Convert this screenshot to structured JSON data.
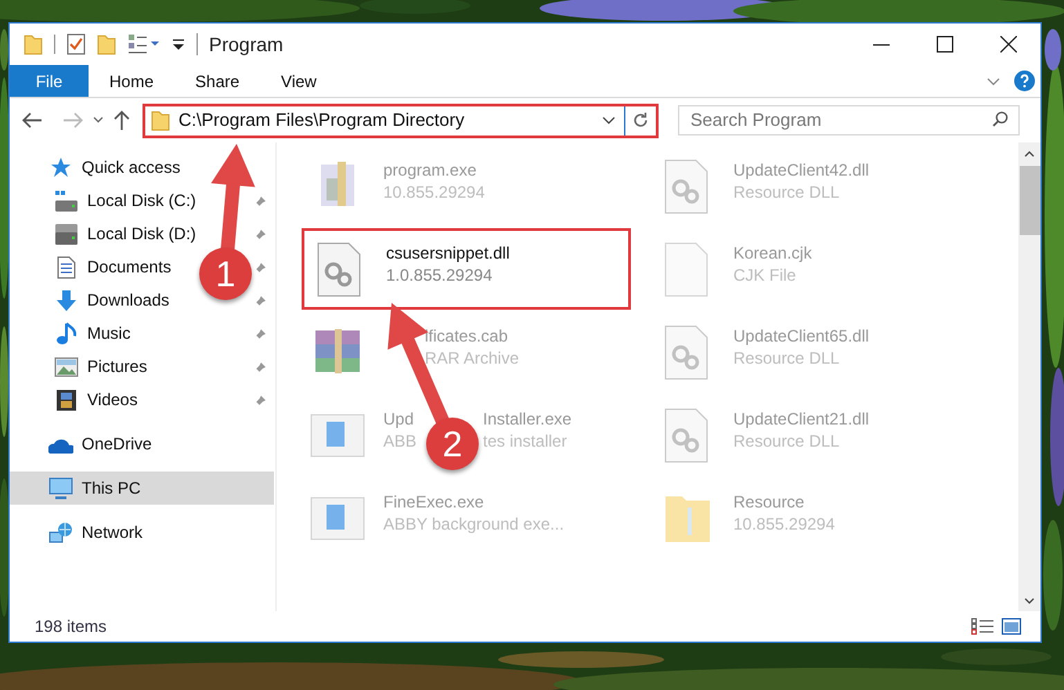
{
  "window": {
    "title": "Program"
  },
  "ribbon_tabs": [
    {
      "label": "File",
      "kind": "file"
    },
    {
      "label": "Home",
      "kind": "tab"
    },
    {
      "label": "Share",
      "kind": "tab"
    },
    {
      "label": "View",
      "kind": "tab"
    }
  ],
  "address_bar": {
    "path": "C:\\Program Files\\Program Directory"
  },
  "search": {
    "placeholder": "Search Program"
  },
  "sidebar": {
    "items": [
      {
        "label": "Quick access",
        "kind": "star",
        "selected": false,
        "children": [
          {
            "label": "Local Disk (C:)",
            "kind": "windrive",
            "pinned": true,
            "selected": false
          },
          {
            "label": "Local Disk (D:)",
            "kind": "drive",
            "pinned": true,
            "selected": false
          },
          {
            "label": "Documents",
            "kind": "doc",
            "pinned": true,
            "selected": false
          },
          {
            "label": "Downloads",
            "kind": "down",
            "pinned": true,
            "selected": false
          },
          {
            "label": "Music",
            "kind": "music",
            "pinned": true,
            "selected": false
          },
          {
            "label": "Pictures",
            "kind": "pictures",
            "pinned": true,
            "selected": false
          },
          {
            "label": "Videos",
            "kind": "videos",
            "pinned": true,
            "selected": false
          }
        ]
      },
      {
        "label": "OneDrive",
        "kind": "cloud",
        "selected": false
      },
      {
        "label": "This PC",
        "kind": "pc",
        "selected": true
      },
      {
        "label": "Network",
        "kind": "network",
        "selected": false
      }
    ]
  },
  "files": [
    {
      "name": "program.exe",
      "detail": "10.855.29294",
      "kind": "exe",
      "highlighted": false
    },
    {
      "name": "UpdateClient42.dll",
      "detail": "Resource DLL",
      "kind": "dll",
      "highlighted": false
    },
    {
      "name": "csusersnippet.dll",
      "detail": "1.0.855.29294",
      "kind": "dll",
      "highlighted": true
    },
    {
      "name": "Korean.cjk",
      "detail": "CJK File",
      "kind": "blank",
      "highlighted": false
    },
    {
      "name": "ificates.cab",
      "detail": "RAR Archive",
      "kind": "archive",
      "highlighted": false
    },
    {
      "name": "UpdateClient65.dll",
      "detail": "Resource DLL",
      "kind": "dll",
      "highlighted": false
    },
    {
      "name": [
        "Upd",
        "Installer.exe"
      ],
      "detail": [
        "ABB",
        "tes installer"
      ],
      "kind": "app",
      "highlighted": false
    },
    {
      "name": "UpdateClient21.dll",
      "detail": "Resource DLL",
      "kind": "dll",
      "highlighted": false
    },
    {
      "name": "FineExec.exe",
      "detail": "ABBY background exe...",
      "kind": "app",
      "highlighted": false
    },
    {
      "name": "Resource",
      "detail": "10.855.29294",
      "kind": "folder",
      "highlighted": false
    }
  ],
  "status_bar": {
    "count": "198 items"
  },
  "annotations": [
    {
      "label": "1"
    },
    {
      "label": "2"
    }
  ]
}
